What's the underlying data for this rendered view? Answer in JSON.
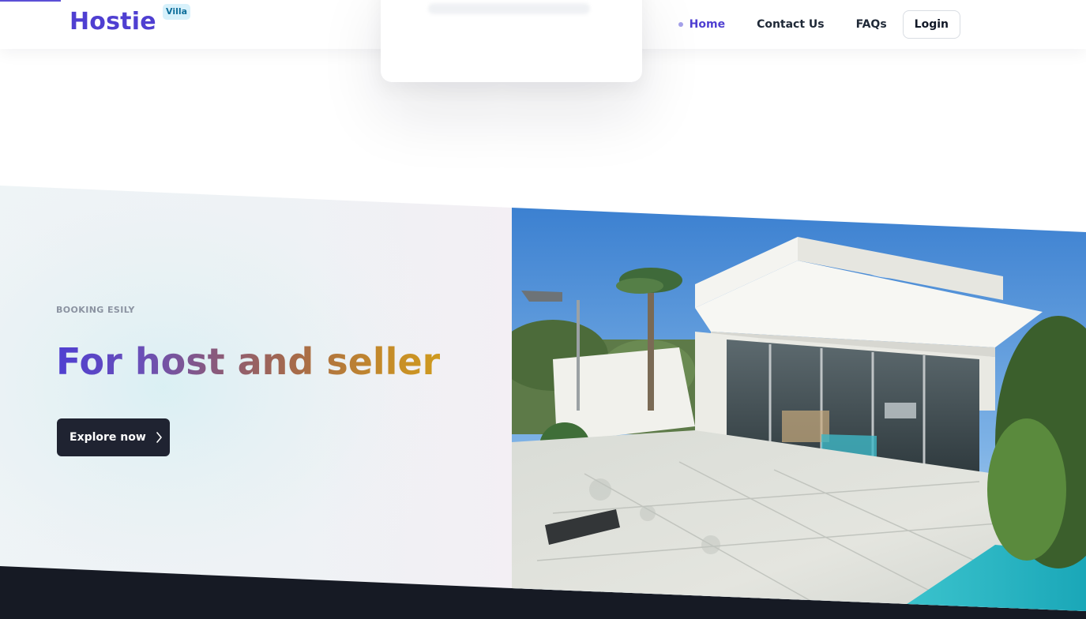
{
  "header": {
    "logo_text": "Hostie",
    "logo_badge": "Villa",
    "nav": [
      {
        "label": "Home",
        "active": true
      },
      {
        "label": "Contact Us",
        "active": false
      },
      {
        "label": "FAQs",
        "active": false
      }
    ],
    "login_label": "Login"
  },
  "hero": {
    "eyebrow": "BOOKING ESILY",
    "headline": "For host and seller",
    "cta_label": "Explore now",
    "cta_icon": "chevron-right-icon"
  },
  "colors": {
    "brand": "#4f3fd1",
    "badge_bg": "#d7f1fb",
    "badge_text": "#0e6f9b",
    "cta_bg": "#1f2331",
    "footer_band": "#161a24"
  }
}
